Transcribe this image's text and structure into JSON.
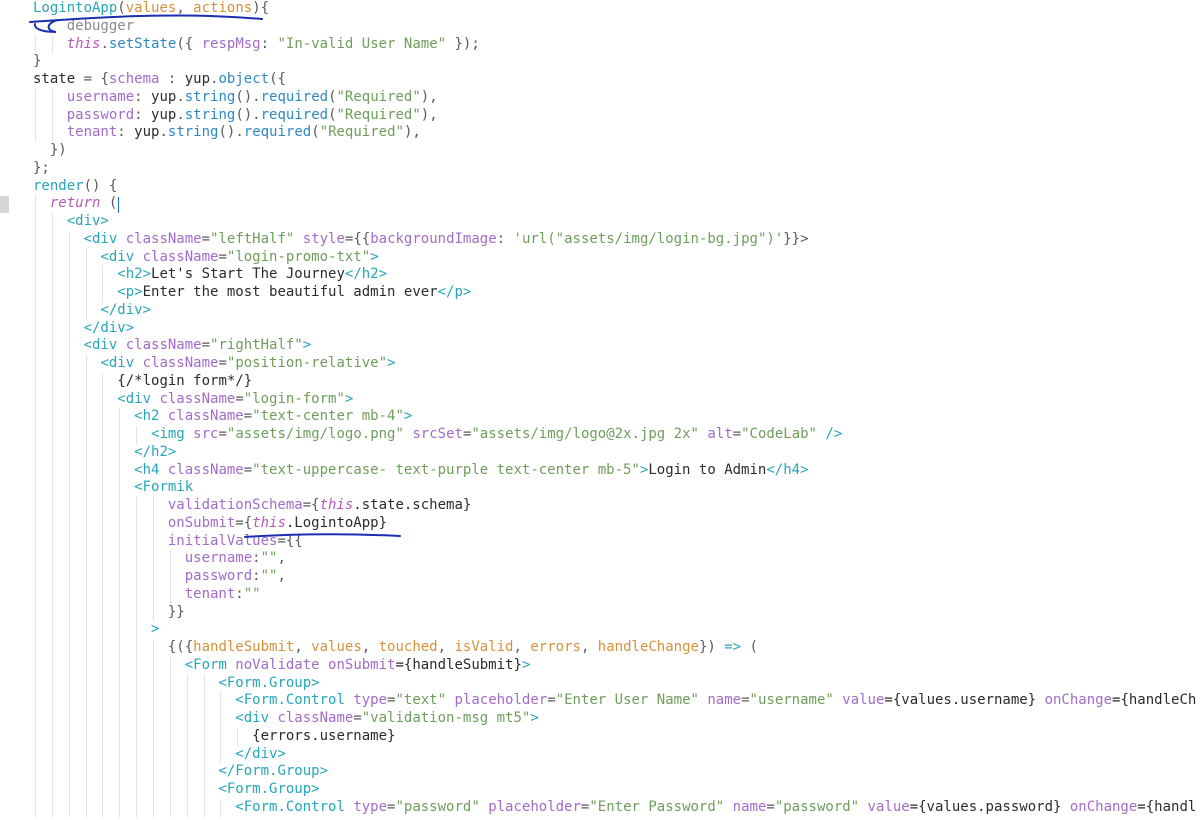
{
  "editor": {
    "lines": [
      [
        {
          "t": "LogintoApp",
          "c": "tok-tag"
        },
        {
          "t": "(",
          "c": "tok-punc"
        },
        {
          "t": "values",
          "c": "tok-param"
        },
        {
          "t": ", ",
          "c": "tok-punc"
        },
        {
          "t": "actions",
          "c": "tok-param"
        },
        {
          "t": "){",
          "c": "tok-punc"
        }
      ],
      [
        {
          "t": "    debugger",
          "c": "tok-com"
        }
      ],
      [
        {
          "t": "    ",
          "c": "tok-def"
        },
        {
          "t": "this",
          "c": "tok-this"
        },
        {
          "t": ".",
          "c": "tok-punc"
        },
        {
          "t": "setState",
          "c": "tok-fn"
        },
        {
          "t": "({ ",
          "c": "tok-punc"
        },
        {
          "t": "respMsg",
          "c": "tok-attr"
        },
        {
          "t": ": ",
          "c": "tok-punc"
        },
        {
          "t": "\"In-valid User Name\"",
          "c": "tok-str"
        },
        {
          "t": " });",
          "c": "tok-punc"
        }
      ],
      [
        {
          "t": "}",
          "c": "tok-punc"
        }
      ],
      [
        {
          "t": "state",
          "c": "tok-def"
        },
        {
          "t": " = {",
          "c": "tok-punc"
        },
        {
          "t": "schema",
          "c": "tok-attr"
        },
        {
          "t": " : ",
          "c": "tok-punc"
        },
        {
          "t": "yup",
          "c": "tok-def"
        },
        {
          "t": ".",
          "c": "tok-punc"
        },
        {
          "t": "object",
          "c": "tok-fn"
        },
        {
          "t": "({",
          "c": "tok-punc"
        }
      ],
      [
        {
          "t": "    ",
          "c": "tok-def"
        },
        {
          "t": "username",
          "c": "tok-attr"
        },
        {
          "t": ": ",
          "c": "tok-punc"
        },
        {
          "t": "yup",
          "c": "tok-def"
        },
        {
          "t": ".",
          "c": "tok-punc"
        },
        {
          "t": "string",
          "c": "tok-fn"
        },
        {
          "t": "().",
          "c": "tok-punc"
        },
        {
          "t": "required",
          "c": "tok-fn"
        },
        {
          "t": "(",
          "c": "tok-punc"
        },
        {
          "t": "\"Required\"",
          "c": "tok-str"
        },
        {
          "t": "),",
          "c": "tok-punc"
        }
      ],
      [
        {
          "t": "    ",
          "c": "tok-def"
        },
        {
          "t": "password",
          "c": "tok-attr"
        },
        {
          "t": ": ",
          "c": "tok-punc"
        },
        {
          "t": "yup",
          "c": "tok-def"
        },
        {
          "t": ".",
          "c": "tok-punc"
        },
        {
          "t": "string",
          "c": "tok-fn"
        },
        {
          "t": "().",
          "c": "tok-punc"
        },
        {
          "t": "required",
          "c": "tok-fn"
        },
        {
          "t": "(",
          "c": "tok-punc"
        },
        {
          "t": "\"Required\"",
          "c": "tok-str"
        },
        {
          "t": "),",
          "c": "tok-punc"
        }
      ],
      [
        {
          "t": "    ",
          "c": "tok-def"
        },
        {
          "t": "tenant",
          "c": "tok-attr"
        },
        {
          "t": ": ",
          "c": "tok-punc"
        },
        {
          "t": "yup",
          "c": "tok-def"
        },
        {
          "t": ".",
          "c": "tok-punc"
        },
        {
          "t": "string",
          "c": "tok-fn"
        },
        {
          "t": "().",
          "c": "tok-punc"
        },
        {
          "t": "required",
          "c": "tok-fn"
        },
        {
          "t": "(",
          "c": "tok-punc"
        },
        {
          "t": "\"Required\"",
          "c": "tok-str"
        },
        {
          "t": "),",
          "c": "tok-punc"
        }
      ],
      [
        {
          "t": "  })",
          "c": "tok-punc"
        }
      ],
      [
        {
          "t": "};",
          "c": "tok-punc"
        }
      ],
      [
        {
          "t": "render",
          "c": "tok-tag"
        },
        {
          "t": "() {",
          "c": "tok-punc"
        }
      ],
      [
        {
          "t": "  ",
          "c": "tok-def"
        },
        {
          "t": "return",
          "c": "tok-kw"
        },
        {
          "t": " (",
          "c": "tok-punc"
        }
      ],
      [
        {
          "t": "    ",
          "c": "tok-def"
        },
        {
          "t": "<div>",
          "c": "tok-tag"
        }
      ],
      [
        {
          "t": "      ",
          "c": "tok-def"
        },
        {
          "t": "<div ",
          "c": "tok-tag"
        },
        {
          "t": "className",
          "c": "tok-attr"
        },
        {
          "t": "=",
          "c": "tok-punc"
        },
        {
          "t": "\"leftHalf\"",
          "c": "tok-str"
        },
        {
          "t": " ",
          "c": "tok-def"
        },
        {
          "t": "style",
          "c": "tok-attr"
        },
        {
          "t": "={{",
          "c": "tok-punc"
        },
        {
          "t": "backgroundImage",
          "c": "tok-attr"
        },
        {
          "t": ": ",
          "c": "tok-punc"
        },
        {
          "t": "'url(\"assets/img/login-bg.jpg\")'",
          "c": "tok-str"
        },
        {
          "t": "}}>",
          "c": "tok-punc"
        }
      ],
      [
        {
          "t": "        ",
          "c": "tok-def"
        },
        {
          "t": "<div ",
          "c": "tok-tag"
        },
        {
          "t": "className",
          "c": "tok-attr"
        },
        {
          "t": "=",
          "c": "tok-punc"
        },
        {
          "t": "\"login-promo-txt\"",
          "c": "tok-str"
        },
        {
          "t": ">",
          "c": "tok-tag"
        }
      ],
      [
        {
          "t": "          ",
          "c": "tok-def"
        },
        {
          "t": "<h2>",
          "c": "tok-tag"
        },
        {
          "t": "Let's Start The Journey",
          "c": "tok-def"
        },
        {
          "t": "</h2>",
          "c": "tok-tag"
        }
      ],
      [
        {
          "t": "          ",
          "c": "tok-def"
        },
        {
          "t": "<p>",
          "c": "tok-tag"
        },
        {
          "t": "Enter the most beautiful admin ever",
          "c": "tok-def"
        },
        {
          "t": "</p>",
          "c": "tok-tag"
        }
      ],
      [
        {
          "t": "        ",
          "c": "tok-def"
        },
        {
          "t": "</div>",
          "c": "tok-tag"
        }
      ],
      [
        {
          "t": "      ",
          "c": "tok-def"
        },
        {
          "t": "</div>",
          "c": "tok-tag"
        }
      ],
      [
        {
          "t": "      ",
          "c": "tok-def"
        },
        {
          "t": "<div ",
          "c": "tok-tag"
        },
        {
          "t": "className",
          "c": "tok-attr"
        },
        {
          "t": "=",
          "c": "tok-punc"
        },
        {
          "t": "\"rightHalf\"",
          "c": "tok-str"
        },
        {
          "t": ">",
          "c": "tok-tag"
        }
      ],
      [
        {
          "t": "        ",
          "c": "tok-def"
        },
        {
          "t": "<div ",
          "c": "tok-tag"
        },
        {
          "t": "className",
          "c": "tok-attr"
        },
        {
          "t": "=",
          "c": "tok-punc"
        },
        {
          "t": "\"position-relative\"",
          "c": "tok-str"
        },
        {
          "t": ">",
          "c": "tok-tag"
        }
      ],
      [
        {
          "t": "          ",
          "c": "tok-def"
        },
        {
          "t": "{/*login form*/}",
          "c": "tok-def"
        }
      ],
      [
        {
          "t": "          ",
          "c": "tok-def"
        },
        {
          "t": "<div ",
          "c": "tok-tag"
        },
        {
          "t": "className",
          "c": "tok-attr"
        },
        {
          "t": "=",
          "c": "tok-punc"
        },
        {
          "t": "\"login-form\"",
          "c": "tok-str"
        },
        {
          "t": ">",
          "c": "tok-tag"
        }
      ],
      [
        {
          "t": "            ",
          "c": "tok-def"
        },
        {
          "t": "<h2 ",
          "c": "tok-tag"
        },
        {
          "t": "className",
          "c": "tok-attr"
        },
        {
          "t": "=",
          "c": "tok-punc"
        },
        {
          "t": "\"text-center mb-4\"",
          "c": "tok-str"
        },
        {
          "t": ">",
          "c": "tok-tag"
        }
      ],
      [
        {
          "t": "              ",
          "c": "tok-def"
        },
        {
          "t": "<img ",
          "c": "tok-tag"
        },
        {
          "t": "src",
          "c": "tok-attr"
        },
        {
          "t": "=",
          "c": "tok-punc"
        },
        {
          "t": "\"assets/img/logo.png\"",
          "c": "tok-str"
        },
        {
          "t": " ",
          "c": "tok-def"
        },
        {
          "t": "srcSet",
          "c": "tok-attr"
        },
        {
          "t": "=",
          "c": "tok-punc"
        },
        {
          "t": "\"assets/img/logo@2x.jpg 2x\"",
          "c": "tok-str"
        },
        {
          "t": " ",
          "c": "tok-def"
        },
        {
          "t": "alt",
          "c": "tok-attr"
        },
        {
          "t": "=",
          "c": "tok-punc"
        },
        {
          "t": "\"CodeLab\"",
          "c": "tok-str"
        },
        {
          "t": " />",
          "c": "tok-tag"
        }
      ],
      [
        {
          "t": "            ",
          "c": "tok-def"
        },
        {
          "t": "</h2>",
          "c": "tok-tag"
        }
      ],
      [
        {
          "t": "            ",
          "c": "tok-def"
        },
        {
          "t": "<h4 ",
          "c": "tok-tag"
        },
        {
          "t": "className",
          "c": "tok-attr"
        },
        {
          "t": "=",
          "c": "tok-punc"
        },
        {
          "t": "\"text-uppercase- text-purple text-center mb-5\"",
          "c": "tok-str"
        },
        {
          "t": ">",
          "c": "tok-tag"
        },
        {
          "t": "Login to Admin",
          "c": "tok-def"
        },
        {
          "t": "</h4>",
          "c": "tok-tag"
        }
      ],
      [
        {
          "t": "            ",
          "c": "tok-def"
        },
        {
          "t": "<Formik",
          "c": "tok-tag"
        }
      ],
      [
        {
          "t": "                ",
          "c": "tok-def"
        },
        {
          "t": "validationSchema",
          "c": "tok-attr"
        },
        {
          "t": "={",
          "c": "tok-punc"
        },
        {
          "t": "this",
          "c": "tok-this"
        },
        {
          "t": ".state.schema}",
          "c": "tok-def"
        }
      ],
      [
        {
          "t": "                ",
          "c": "tok-def"
        },
        {
          "t": "onSubmit",
          "c": "tok-attr"
        },
        {
          "t": "={",
          "c": "tok-punc"
        },
        {
          "t": "this",
          "c": "tok-this"
        },
        {
          "t": ".LogintoApp}",
          "c": "tok-def"
        }
      ],
      [
        {
          "t": "                ",
          "c": "tok-def"
        },
        {
          "t": "initialValues",
          "c": "tok-attr"
        },
        {
          "t": "={{",
          "c": "tok-punc"
        }
      ],
      [
        {
          "t": "                  ",
          "c": "tok-def"
        },
        {
          "t": "username",
          "c": "tok-attr"
        },
        {
          "t": ":",
          "c": "tok-punc"
        },
        {
          "t": "\"\"",
          "c": "tok-str"
        },
        {
          "t": ",",
          "c": "tok-punc"
        }
      ],
      [
        {
          "t": "                  ",
          "c": "tok-def"
        },
        {
          "t": "password",
          "c": "tok-attr"
        },
        {
          "t": ":",
          "c": "tok-punc"
        },
        {
          "t": "\"\"",
          "c": "tok-str"
        },
        {
          "t": ",",
          "c": "tok-punc"
        }
      ],
      [
        {
          "t": "                  ",
          "c": "tok-def"
        },
        {
          "t": "tenant",
          "c": "tok-attr"
        },
        {
          "t": ":",
          "c": "tok-punc"
        },
        {
          "t": "\"\"",
          "c": "tok-str"
        }
      ],
      [
        {
          "t": "                ",
          "c": "tok-def"
        },
        {
          "t": "}}",
          "c": "tok-punc"
        }
      ],
      [
        {
          "t": "              ",
          "c": "tok-def"
        },
        {
          "t": ">",
          "c": "tok-tag"
        }
      ],
      [
        {
          "t": "                ",
          "c": "tok-def"
        },
        {
          "t": "{({",
          "c": "tok-punc"
        },
        {
          "t": "handleSubmit",
          "c": "tok-param"
        },
        {
          "t": ", ",
          "c": "tok-punc"
        },
        {
          "t": "values",
          "c": "tok-param"
        },
        {
          "t": ", ",
          "c": "tok-punc"
        },
        {
          "t": "touched",
          "c": "tok-param"
        },
        {
          "t": ", ",
          "c": "tok-punc"
        },
        {
          "t": "isValid",
          "c": "tok-param"
        },
        {
          "t": ", ",
          "c": "tok-punc"
        },
        {
          "t": "errors",
          "c": "tok-param"
        },
        {
          "t": ", ",
          "c": "tok-punc"
        },
        {
          "t": "handleChange",
          "c": "tok-param"
        },
        {
          "t": "}) ",
          "c": "tok-punc"
        },
        {
          "t": "=>",
          "c": "tok-tag"
        },
        {
          "t": " (",
          "c": "tok-punc"
        }
      ],
      [
        {
          "t": "                  ",
          "c": "tok-def"
        },
        {
          "t": "<Form ",
          "c": "tok-tag"
        },
        {
          "t": "noValidate",
          "c": "tok-attr"
        },
        {
          "t": " ",
          "c": "tok-def"
        },
        {
          "t": "onSubmit",
          "c": "tok-attr"
        },
        {
          "t": "={handleSubmit}",
          "c": "tok-def"
        },
        {
          "t": ">",
          "c": "tok-tag"
        }
      ],
      [
        {
          "t": "                      ",
          "c": "tok-def"
        },
        {
          "t": "<Form.Group>",
          "c": "tok-tag"
        }
      ],
      [
        {
          "t": "                        ",
          "c": "tok-def"
        },
        {
          "t": "<Form.Control ",
          "c": "tok-tag"
        },
        {
          "t": "type",
          "c": "tok-attr"
        },
        {
          "t": "=",
          "c": "tok-punc"
        },
        {
          "t": "\"text\"",
          "c": "tok-str"
        },
        {
          "t": " ",
          "c": "tok-def"
        },
        {
          "t": "placeholder",
          "c": "tok-attr"
        },
        {
          "t": "=",
          "c": "tok-punc"
        },
        {
          "t": "\"Enter User Name\"",
          "c": "tok-str"
        },
        {
          "t": " ",
          "c": "tok-def"
        },
        {
          "t": "name",
          "c": "tok-attr"
        },
        {
          "t": "=",
          "c": "tok-punc"
        },
        {
          "t": "\"username\"",
          "c": "tok-str"
        },
        {
          "t": " ",
          "c": "tok-def"
        },
        {
          "t": "value",
          "c": "tok-attr"
        },
        {
          "t": "={values.username}",
          "c": "tok-def"
        },
        {
          "t": " ",
          "c": "tok-def"
        },
        {
          "t": "onChange",
          "c": "tok-attr"
        },
        {
          "t": "={handleCh",
          "c": "tok-def"
        }
      ],
      [
        {
          "t": "                        ",
          "c": "tok-def"
        },
        {
          "t": "<div ",
          "c": "tok-tag"
        },
        {
          "t": "className",
          "c": "tok-attr"
        },
        {
          "t": "=",
          "c": "tok-punc"
        },
        {
          "t": "\"validation-msg mt5\"",
          "c": "tok-str"
        },
        {
          "t": ">",
          "c": "tok-tag"
        }
      ],
      [
        {
          "t": "                          ",
          "c": "tok-def"
        },
        {
          "t": "{errors.username}",
          "c": "tok-def"
        }
      ],
      [
        {
          "t": "                        ",
          "c": "tok-def"
        },
        {
          "t": "</div>",
          "c": "tok-tag"
        }
      ],
      [
        {
          "t": "                      ",
          "c": "tok-def"
        },
        {
          "t": "</Form.Group>",
          "c": "tok-tag"
        }
      ],
      [
        {
          "t": "                      ",
          "c": "tok-def"
        },
        {
          "t": "<Form.Group>",
          "c": "tok-tag"
        }
      ],
      [
        {
          "t": "                        ",
          "c": "tok-def"
        },
        {
          "t": "<Form.Control ",
          "c": "tok-tag"
        },
        {
          "t": "type",
          "c": "tok-attr"
        },
        {
          "t": "=",
          "c": "tok-punc"
        },
        {
          "t": "\"password\"",
          "c": "tok-str"
        },
        {
          "t": " ",
          "c": "tok-def"
        },
        {
          "t": "placeholder",
          "c": "tok-attr"
        },
        {
          "t": "=",
          "c": "tok-punc"
        },
        {
          "t": "\"Enter Password\"",
          "c": "tok-str"
        },
        {
          "t": " ",
          "c": "tok-def"
        },
        {
          "t": "name",
          "c": "tok-attr"
        },
        {
          "t": "=",
          "c": "tok-punc"
        },
        {
          "t": "\"password\"",
          "c": "tok-str"
        },
        {
          "t": " ",
          "c": "tok-def"
        },
        {
          "t": "value",
          "c": "tok-attr"
        },
        {
          "t": "={values.password}",
          "c": "tok-def"
        },
        {
          "t": " ",
          "c": "tok-def"
        },
        {
          "t": "onChange",
          "c": "tok-attr"
        },
        {
          "t": "={handl",
          "c": "tok-def"
        }
      ]
    ]
  },
  "colors": {
    "annotation_ink": "#1a2fb0",
    "cursor": "#1e6fd0"
  }
}
